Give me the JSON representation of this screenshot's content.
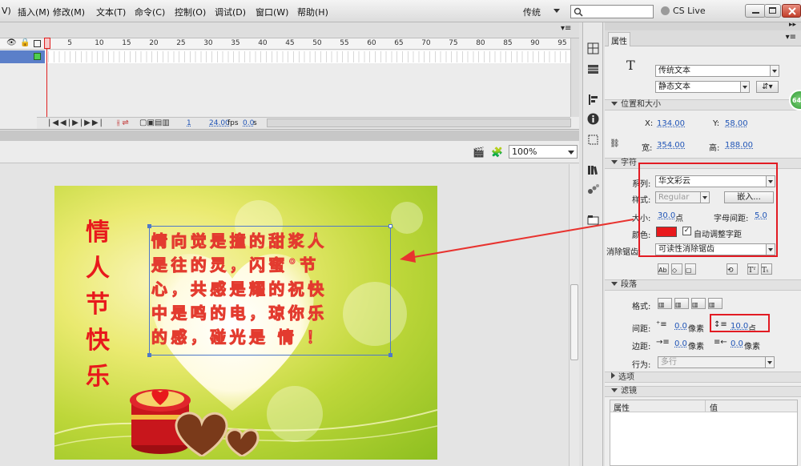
{
  "menu": [
    "V)",
    "插入(M)",
    "修改(M)",
    "文本(T)",
    "命令(C)",
    "控制(O)",
    "调试(D)",
    "窗口(W)",
    "帮助(H)"
  ],
  "workspace_mode": "传统",
  "cslive_label": "CS Live",
  "timeline": {
    "frame_ticks": [
      "1",
      "5",
      "10",
      "15",
      "20",
      "25",
      "30",
      "35",
      "40",
      "45",
      "50",
      "55",
      "60",
      "65",
      "70",
      "75",
      "80",
      "85",
      "90",
      "95"
    ],
    "current_frame": "1",
    "fps": "24.00",
    "fps_unit": "fps",
    "time": "0.0",
    "time_unit": "s"
  },
  "zoom": "100%",
  "stage": {
    "vertical_title": [
      "情",
      "人",
      "节",
      "快",
      "乐"
    ],
    "text_lines": [
      "情向觉是撞的甜浆人",
      "是往的灵，闪蜜°节",
      "心，共感是耀的祝快",
      "中是鸣的电，琼你乐",
      "的感，碰光是  情 ！"
    ]
  },
  "props": {
    "tab_label": "属性",
    "text_type": "传统文本",
    "text_mode": "静态文本",
    "pos_section": "位置和大小",
    "x_label": "X:",
    "x_value": "134.00",
    "y_label": "Y:",
    "y_value": "58.00",
    "w_label": "宽:",
    "w_value": "354.00",
    "h_label": "高:",
    "h_value": "188.00",
    "char_section": "字符",
    "family_label": "系列:",
    "family_value": "华文彩云",
    "style_label": "样式:",
    "style_value": "Regular",
    "embed_label": "嵌入...",
    "size_label": "大小:",
    "size_value": "30.0",
    "size_unit": "点",
    "spacing_label": "字母间距:",
    "spacing_value": "5.0",
    "color_label": "颜色:",
    "color_value": "#e8191c",
    "autokern_label": "自动调整字距",
    "aa_label": "消除锯齿:",
    "aa_value": "可读性消除锯齿",
    "para_section": "段落",
    "format_label": "格式:",
    "gap_label": "间距:",
    "gap_indent": "0.0",
    "gap_indent_unit": "像素",
    "line_gap": "10.0",
    "line_gap_unit": "点",
    "margin_label": "边距:",
    "margin_left": "0.0",
    "margin_left_unit": "像素",
    "margin_right": "0.0",
    "margin_right_unit": "像素",
    "behavior_label": "行为:",
    "behavior_value": "多行",
    "options_section": "选项",
    "filters_section": "滤镜",
    "col_prop": "属性",
    "col_value": "值"
  },
  "badge": "64"
}
